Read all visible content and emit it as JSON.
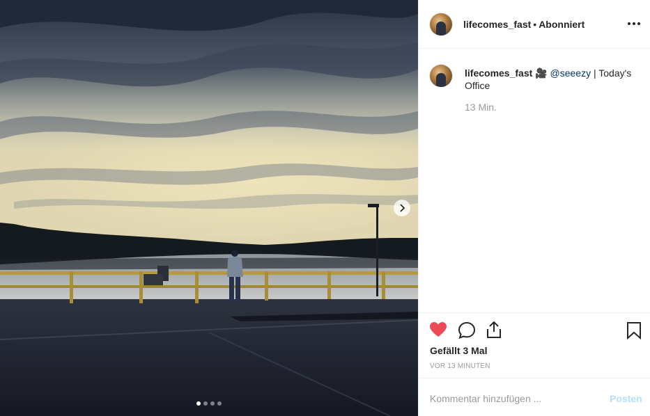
{
  "header": {
    "username": "lifecomes_fast",
    "separator": "•",
    "follow_status": "Abonniert"
  },
  "caption": {
    "username": "lifecomes_fast",
    "emoji": "🎥",
    "mention": "@seeezy",
    "text": " | Today's Office",
    "time": "13 Min."
  },
  "actions": {
    "liked": true,
    "likes_text": "Gefällt 3 Mal",
    "timestamp": "VOR 13 MINUTEN"
  },
  "comment": {
    "placeholder": "Kommentar hinzufügen ...",
    "post_label": "Posten"
  },
  "carousel": {
    "slide_count": 4,
    "active_index": 0
  },
  "colors": {
    "like_red": "#ed4956",
    "mention_blue": "#003569",
    "post_disabled": "#b2dffc",
    "muted_text": "#999999"
  }
}
